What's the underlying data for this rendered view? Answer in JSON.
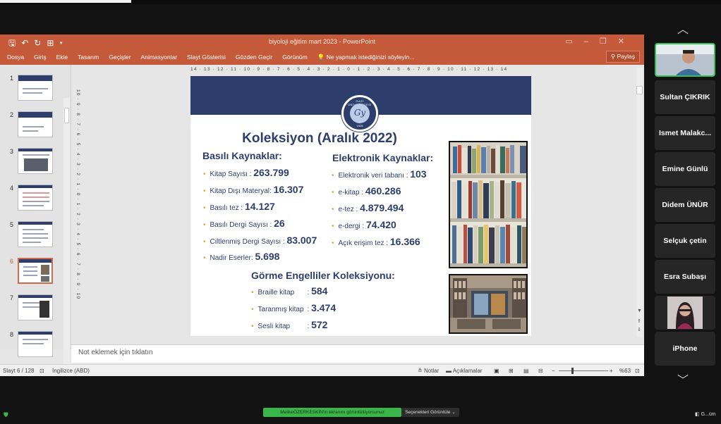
{
  "window": {
    "title": "biyoloji eğitim mart 2023 - PowerPoint",
    "quick_access_icons": [
      "save-icon",
      "undo-icon",
      "redo-icon",
      "present-icon",
      "customize-icon"
    ]
  },
  "ribbon": {
    "tabs": [
      "Dosya",
      "Giriş",
      "Ekle",
      "Tasarım",
      "Geçişler",
      "Animasyonlar",
      "Slayt Gösterisi",
      "Gözden Geçir",
      "Görünüm"
    ],
    "tell_me": "Ne yapmak istediğinizi söyleyin...",
    "share": "Paylaş"
  },
  "thumbnails": {
    "items": [
      "1",
      "2",
      "3",
      "4",
      "5",
      "6",
      "7",
      "8"
    ],
    "selected": "6"
  },
  "ruler": {
    "horizontal": "14 · 13 · 12 · 11 · 10 · 9 · 8 · 7 · 6 · 5 · 4 · 3 · 2 · 1 · 0 · 1 · 2 · 3 · 4 · 5 · 6 · 7 · 8 · 9 · 10 · 11 · 12 · 13 · 14",
    "vertical": "10 · 9 · 8 · 7 · 6 · 5 · 4 · 3 · 2 · 1 · 0 · 1 · 2 · 3 · 4 · 5 · 6 · 7 · 8 · 9 · 10"
  },
  "slide": {
    "title": "Koleksiyon (Aralık 2022)",
    "seal": {
      "ring_text": "GAZİ ÜNİVERSİTESİ",
      "year": "1926",
      "letter": "Gy"
    },
    "printed": {
      "heading": "Basılı Kaynaklar:",
      "items": [
        {
          "label": "Kitap Sayısı :",
          "value": "263.799"
        },
        {
          "label": "Kitap Dışı Materyal:",
          "value": "16.307"
        },
        {
          "label": "Basılı tez :",
          "value": "14.127"
        },
        {
          "label": "Basılı Dergi Sayısı :",
          "value": "26"
        },
        {
          "label": "Ciltlenmiş Dergi Sayısı :",
          "value": "83.007"
        },
        {
          "label": "Nadir Eserler:",
          "value": "5.698"
        }
      ]
    },
    "electronic": {
      "heading": "Elektronik Kaynaklar:",
      "items": [
        {
          "label": "Elektronik veri tabanı :",
          "value": "103"
        },
        {
          "label": "e-kitap :",
          "value": "460.286"
        },
        {
          "label": "e-tez :",
          "value": "4.879.494"
        },
        {
          "label": "e-dergi :",
          "value": "74.420"
        },
        {
          "label": "Açık erişim tez :",
          "value": "16.366"
        }
      ]
    },
    "visually_impaired": {
      "heading": "Görme Engelliler Koleksiyonu:",
      "items": [
        {
          "label": "Braille kitap",
          "sep": ":",
          "value": "584"
        },
        {
          "label": "Taranmış kitap",
          "sep": ":",
          "value": "3.474"
        },
        {
          "label": "Sesli kitap",
          "sep": ":",
          "value": "572"
        }
      ]
    }
  },
  "notes": {
    "placeholder": "Not eklemek için tıklatın"
  },
  "status": {
    "slide": "Slayt 6 / 128",
    "language": "İngilizce (ABD)",
    "notes": "Notlar",
    "comments": "Açıklamalar",
    "zoom": "%63"
  },
  "participants": [
    "Sultan ÇIKRIK",
    "Ismet Malakc...",
    "Emine Günlü",
    "Didem ÜNÜR",
    "Selçuk çetin",
    "Esra Subaşı",
    "iPhone"
  ],
  "zoom_bar": {
    "sharing_notice": "MelikeÖZERKESKİN'in ekranını görüntülüyorsunuz",
    "view_options": "Seçenekleri Görüntüle",
    "view_mode": "G...üm"
  },
  "colors": {
    "accent": "#c55a3a",
    "slide_navy": "#2d3e6c",
    "bullet": "#e0a63b",
    "zoom_green": "#3bb54a"
  }
}
